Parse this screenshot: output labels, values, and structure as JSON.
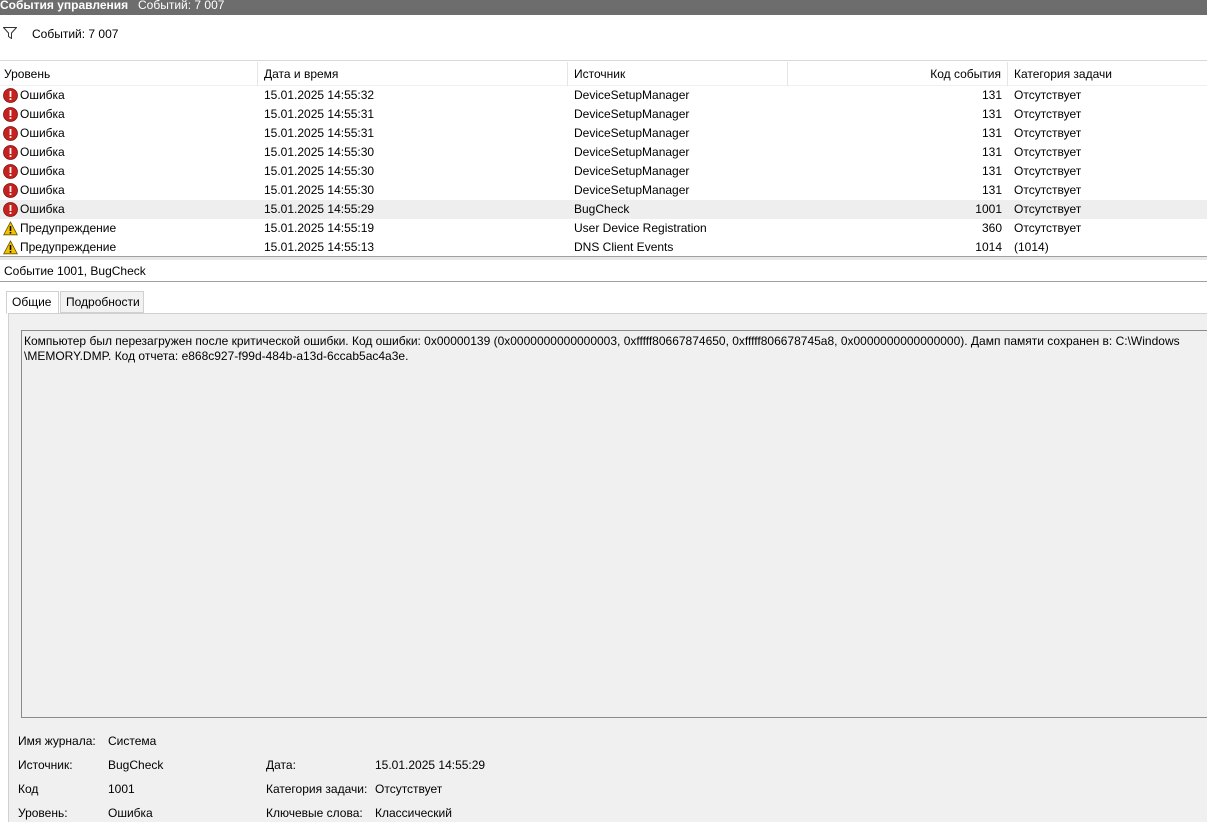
{
  "titlebar": {
    "title": "События управления",
    "count": "Событий: 7 007"
  },
  "filter": {
    "icon": "filter-icon",
    "count": "Событий: 7 007"
  },
  "grid": {
    "columns": [
      "Уровень",
      "Дата и время",
      "Источник",
      "Код события",
      "Категория задачи"
    ],
    "rows": [
      {
        "level": "Ошибка",
        "icon": "error-icon",
        "date": "15.01.2025 14:55:32",
        "source": "DeviceSetupManager",
        "code": "131",
        "category": "Отсутствует"
      },
      {
        "level": "Ошибка",
        "icon": "error-icon",
        "date": "15.01.2025 14:55:31",
        "source": "DeviceSetupManager",
        "code": "131",
        "category": "Отсутствует"
      },
      {
        "level": "Ошибка",
        "icon": "error-icon",
        "date": "15.01.2025 14:55:31",
        "source": "DeviceSetupManager",
        "code": "131",
        "category": "Отсутствует"
      },
      {
        "level": "Ошибка",
        "icon": "error-icon",
        "date": "15.01.2025 14:55:30",
        "source": "DeviceSetupManager",
        "code": "131",
        "category": "Отсутствует"
      },
      {
        "level": "Ошибка",
        "icon": "error-icon",
        "date": "15.01.2025 14:55:30",
        "source": "DeviceSetupManager",
        "code": "131",
        "category": "Отсутствует"
      },
      {
        "level": "Ошибка",
        "icon": "error-icon",
        "date": "15.01.2025 14:55:30",
        "source": "DeviceSetupManager",
        "code": "131",
        "category": "Отсутствует"
      },
      {
        "level": "Ошибка",
        "icon": "error-icon",
        "date": "15.01.2025 14:55:29",
        "source": "BugCheck",
        "code": "1001",
        "category": "Отсутствует"
      },
      {
        "level": "Предупреждение",
        "icon": "warning-icon",
        "date": "15.01.2025 14:55:19",
        "source": "User Device Registration",
        "code": "360",
        "category": "Отсутствует"
      },
      {
        "level": "Предупреждение",
        "icon": "warning-icon",
        "date": "15.01.2025 14:55:13",
        "source": "DNS Client Events",
        "code": "1014",
        "category": "(1014)"
      }
    ]
  },
  "detail": {
    "title": "Событие 1001, BugCheck",
    "tabs": [
      "Общие",
      "Подробности"
    ],
    "description_line1": "Компьютер был перезагружен после критической ошибки.  Код ошибки: 0x00000139 (0x0000000000000003, 0xfffff80667874650, 0xfffff806678745a8, 0x0000000000000000). Дамп памяти сохранен в: C:\\Windows",
    "description_line2": "\\MEMORY.DMP. Код отчета: e868c927-f99d-484b-a13d-6ccab5ac4a3e.",
    "props": {
      "log_label": "Имя журнала:",
      "log_value": "Система",
      "source_label": "Источник:",
      "source_value": "BugCheck",
      "date_label": "Дата:",
      "date_value": "15.01.2025 14:55:29",
      "code_label": "Код",
      "code_value": "1001",
      "category_label": "Категория задачи:",
      "category_value": "Отсутствует",
      "level_label": "Уровень:",
      "level_value": "Ошибка",
      "keywords_label": "Ключевые слова:",
      "keywords_value": "Классический"
    }
  },
  "colors": {
    "error": "#c5221f",
    "warning": "#f2c200",
    "titlebar": "#6d6d6d",
    "selected_row": "#eeeeee"
  }
}
